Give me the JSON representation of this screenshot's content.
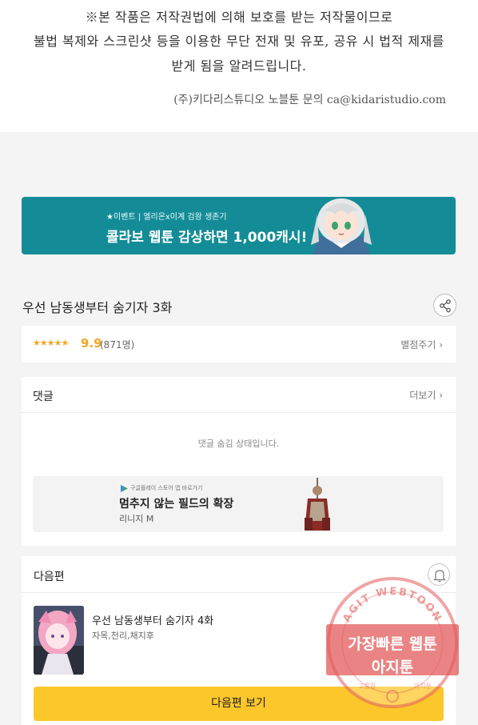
{
  "notice": {
    "line1": "※본 작품은 저작권법에 의해 보호를 받는 저작물이므로",
    "line2": "불법 복제와 스크린샷 등을 이용한 무단 전재 및 유포, 공유 시 법적 제재를",
    "line3": "받게 됨을 알려드립니다.",
    "contact": "(주)키다리스튜디오 노블툰 문의 ca@kidaristudio.com"
  },
  "banner": {
    "small_text": "★이벤트 | 엘리온x이계 검왕 생존기",
    "big_text": "콜라보 웹툰 감상하면 1,000캐시!"
  },
  "episode": {
    "title": "우선 남동생부터 숨기자 3화",
    "share_icon": "share-icon"
  },
  "rating": {
    "stars": "★★★★★",
    "score": "9.9",
    "count": "(871명)",
    "rate_link": "별점주기 ›"
  },
  "comments": {
    "title": "댓글",
    "more": "더보기 ›",
    "hidden_msg": "댓글 숨김 상태입니다."
  },
  "ad": {
    "store_text": "구글플레이 스토어 앱 바로가기",
    "title": "멈추지 않는 필드의 확장",
    "subtitle": "리니지 M"
  },
  "next": {
    "title": "다음편",
    "episode_title": "우선 남동생부터 숨기자 4화",
    "authors": "자목,천리,채지후",
    "button_label": "다음편 보기",
    "bell_icon": "bell-icon"
  },
  "stamp": {
    "top_text": "AGIT WEBTOON",
    "line1": "가장빠른 웹툰",
    "line2": "아지툰",
    "bottom_left": "고품질",
    "bottom_right": "아지툰"
  },
  "colors": {
    "banner_bg": "#148c97",
    "star_color": "#f5a623",
    "button_bg": "#fcc72b",
    "stamp_red": "#e35b5b"
  }
}
